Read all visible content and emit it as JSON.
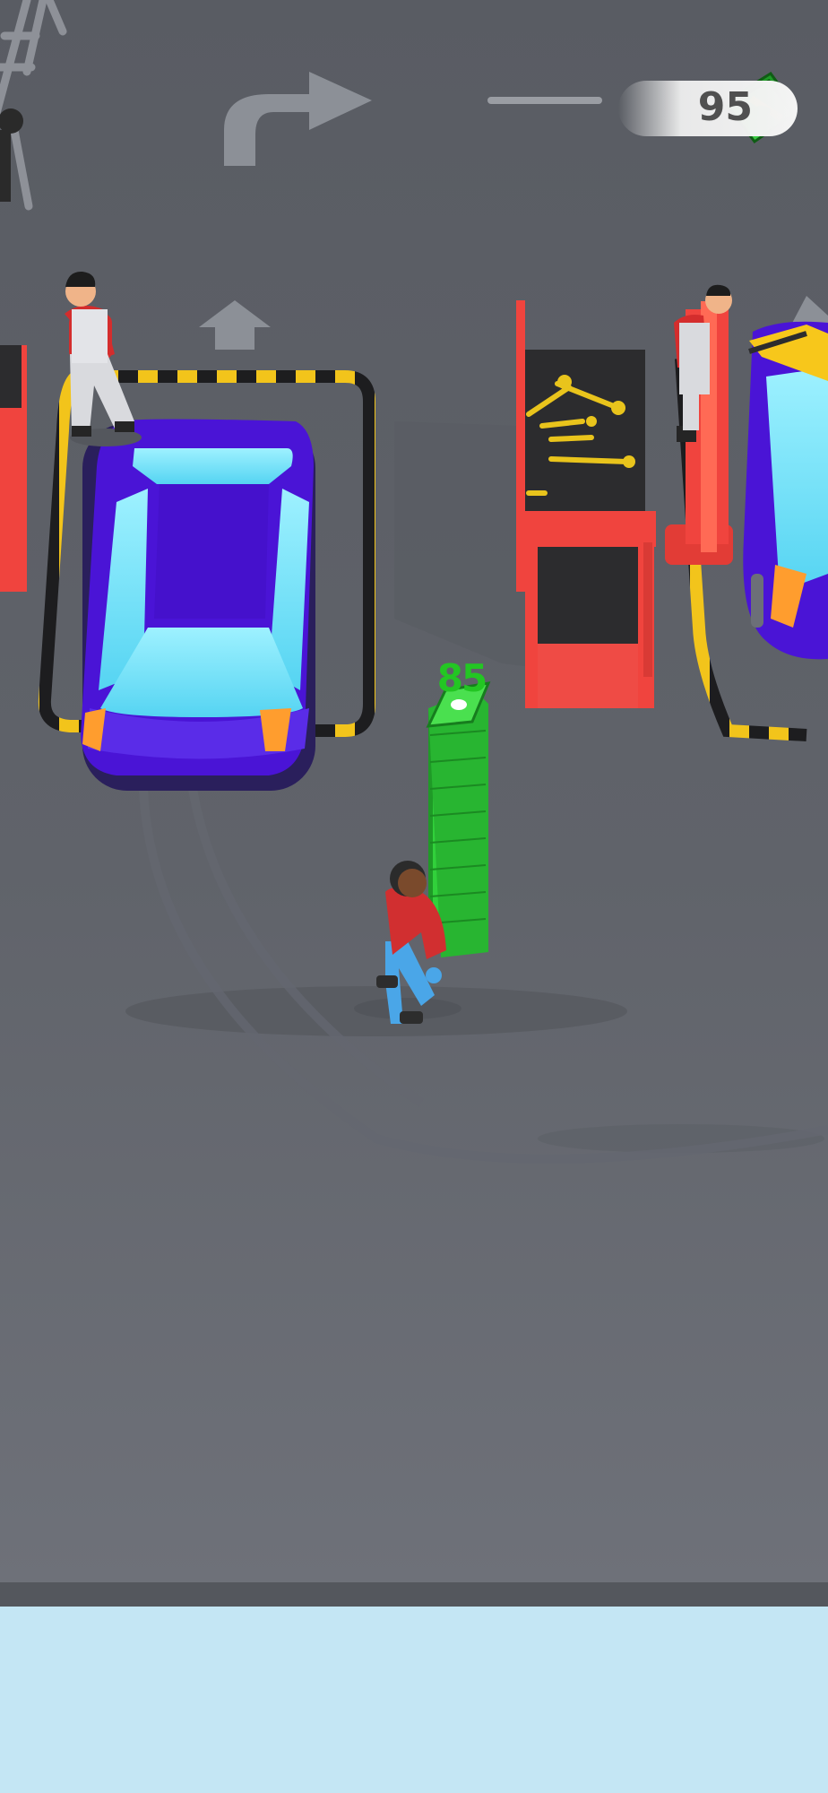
{
  "hud": {
    "cash_amount": "95",
    "cash_icon": "cash-bundle-icon",
    "level_progress": 0
  },
  "player": {
    "carried_cash_label": "85"
  },
  "scene": {
    "floor_color": "#6b6f78",
    "lane_stripe_colors": [
      "#f2c41b",
      "#1d1d1f"
    ],
    "car_color": "#4a14d6",
    "accent_red": "#f0443e",
    "bottom_panel_color": "#c4e6f4"
  }
}
